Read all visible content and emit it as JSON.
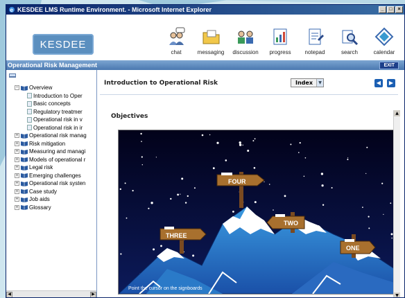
{
  "window": {
    "title": "KESDEE LMS Runtime Environment. - Microsoft Internet Explorer"
  },
  "header": {
    "logo": "KESDEE",
    "toolbar": [
      {
        "label": "chat",
        "icon": "chat-icon"
      },
      {
        "label": "messaging",
        "icon": "messaging-icon"
      },
      {
        "label": "discussion",
        "icon": "discussion-icon"
      },
      {
        "label": "progress",
        "icon": "progress-icon"
      },
      {
        "label": "notepad",
        "icon": "notepad-icon"
      },
      {
        "label": "search",
        "icon": "search-icon"
      },
      {
        "label": "calendar",
        "icon": "calendar-icon"
      }
    ]
  },
  "course_bar": {
    "title": "Operational Risk Management",
    "exit_label": "EXIT"
  },
  "tree": {
    "items": [
      {
        "label": "Overview",
        "type": "open"
      },
      {
        "label": "Introduction to Oper",
        "type": "page"
      },
      {
        "label": "Basic concepts",
        "type": "page"
      },
      {
        "label": "Regulatory treatmer",
        "type": "page"
      },
      {
        "label": "Operational risk in v",
        "type": "page"
      },
      {
        "label": "Operational risk in ir",
        "type": "page"
      },
      {
        "label": "Operational risk manag",
        "type": "closed"
      },
      {
        "label": "Risk mitigation",
        "type": "closed"
      },
      {
        "label": "Measuring and managi",
        "type": "closed"
      },
      {
        "label": "Models of operational r",
        "type": "closed"
      },
      {
        "label": "Legal risk",
        "type": "closed"
      },
      {
        "label": "Emerging challenges",
        "type": "closed"
      },
      {
        "label": "Operational risk systen",
        "type": "closed"
      },
      {
        "label": "Case study",
        "type": "closed"
      },
      {
        "label": "Job aids",
        "type": "closed"
      },
      {
        "label": "Glossary",
        "type": "closed"
      }
    ]
  },
  "content": {
    "title": "Introduction to Operational Risk",
    "index_label": "Index",
    "section": "Objectives",
    "signs": [
      "FOUR",
      "TWO",
      "THREE",
      "ONE"
    ],
    "caption": "Point the cursor on the signboards"
  },
  "colors": {
    "title_bar": "#0a246a",
    "course_bar": "#4a78b0",
    "nav_button": "#1b5fb3"
  }
}
